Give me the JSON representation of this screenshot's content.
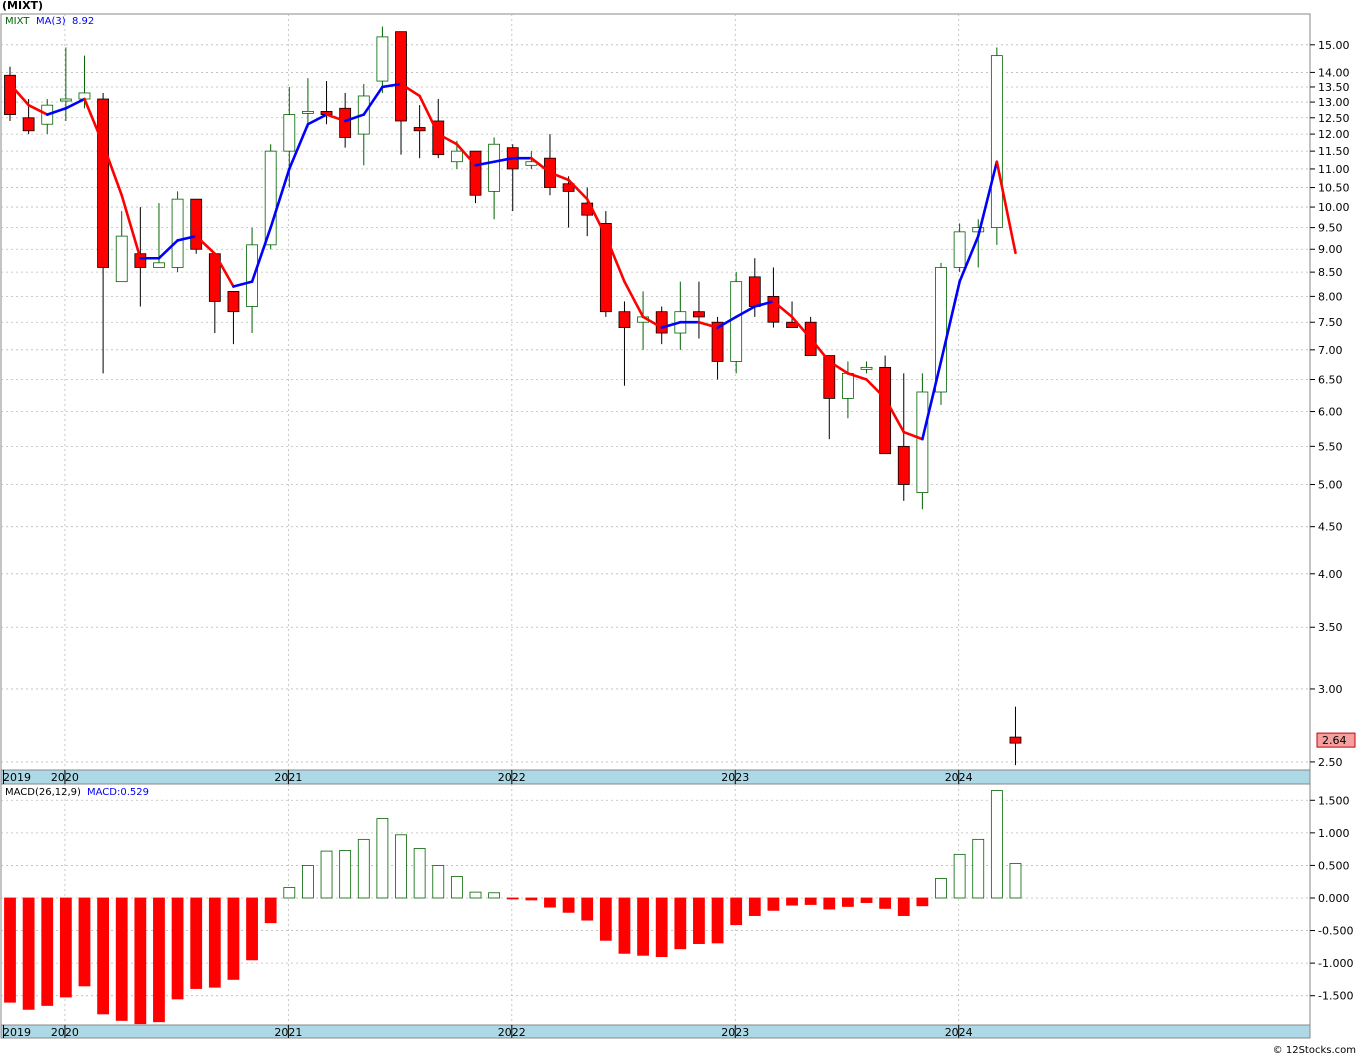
{
  "symbol": "(MIXT)",
  "credit": "© 12Stocks.com",
  "colors": {
    "up": "#006400",
    "down": "#ff0000",
    "ma_up": "#0000ff",
    "ma_down": "#ff0000",
    "axis_band": "#add8e6",
    "grid": "#bbbbbb"
  },
  "chart_data": [
    {
      "type": "candlestick",
      "legend": {
        "symbol": "MIXT",
        "ma_label": "MA(3)",
        "ma_value": "8.92"
      },
      "scale": "log",
      "ylim": [
        2.45,
        16.2
      ],
      "price_ticks": [
        "2.50",
        "3.00",
        "3.50",
        "4.00",
        "4.50",
        "5.00",
        "5.50",
        "6.00",
        "6.50",
        "7.00",
        "7.50",
        "8.00",
        "8.50",
        "9.00",
        "9.50",
        "10.00",
        "10.50",
        "11.00",
        "11.50",
        "12.00",
        "12.50",
        "13.00",
        "13.50",
        "14.00",
        "15.00"
      ],
      "year_labels": [
        "2019",
        "2020",
        "2021",
        "2022",
        "2023",
        "2024"
      ],
      "last_price_label": "2.64",
      "candles": [
        {
          "date": "2019-11",
          "o": 13.9,
          "h": 14.2,
          "l": 12.4,
          "c": 12.6
        },
        {
          "date": "2019-12",
          "o": 12.5,
          "h": 13.1,
          "l": 12.0,
          "c": 12.1
        },
        {
          "date": "2020-01",
          "o": 12.3,
          "h": 13.1,
          "l": 12.0,
          "c": 12.9
        },
        {
          "date": "2020-02",
          "o": 13.1,
          "h": 14.9,
          "l": 12.4,
          "c": 13.1
        },
        {
          "date": "2020-03",
          "o": 13.1,
          "h": 14.6,
          "l": 12.8,
          "c": 13.3
        },
        {
          "date": "2020-04",
          "o": 13.1,
          "h": 13.3,
          "l": 6.6,
          "c": 8.6
        },
        {
          "date": "2020-05",
          "o": 8.3,
          "h": 9.9,
          "l": 8.3,
          "c": 9.3
        },
        {
          "date": "2020-06",
          "o": 8.9,
          "h": 10.0,
          "l": 7.8,
          "c": 8.6
        },
        {
          "date": "2020-07",
          "o": 8.6,
          "h": 10.1,
          "l": 8.6,
          "c": 8.7
        },
        {
          "date": "2020-08",
          "o": 8.6,
          "h": 10.4,
          "l": 8.5,
          "c": 10.2
        },
        {
          "date": "2020-09",
          "o": 10.2,
          "h": 10.2,
          "l": 8.9,
          "c": 9.0
        },
        {
          "date": "2020-10",
          "o": 8.9,
          "h": 8.9,
          "l": 7.3,
          "c": 7.9
        },
        {
          "date": "2020-11",
          "o": 8.1,
          "h": 8.1,
          "l": 7.1,
          "c": 7.7
        },
        {
          "date": "2020-12",
          "o": 7.8,
          "h": 9.5,
          "l": 7.3,
          "c": 9.1
        },
        {
          "date": "2021-01",
          "o": 9.1,
          "h": 11.7,
          "l": 9.0,
          "c": 11.5
        },
        {
          "date": "2021-02",
          "o": 11.5,
          "h": 13.5,
          "l": 10.5,
          "c": 12.6
        },
        {
          "date": "2021-03",
          "o": 12.7,
          "h": 13.8,
          "l": 12.2,
          "c": 12.7
        },
        {
          "date": "2021-04",
          "o": 12.7,
          "h": 13.7,
          "l": 12.3,
          "c": 12.6
        },
        {
          "date": "2021-05",
          "o": 12.8,
          "h": 13.3,
          "l": 11.6,
          "c": 11.9
        },
        {
          "date": "2021-06",
          "o": 12.0,
          "h": 13.6,
          "l": 11.1,
          "c": 13.2
        },
        {
          "date": "2021-07",
          "o": 13.7,
          "h": 15.7,
          "l": 13.3,
          "c": 15.3
        },
        {
          "date": "2021-08",
          "o": 15.5,
          "h": 15.5,
          "l": 11.4,
          "c": 12.4
        },
        {
          "date": "2021-09",
          "o": 12.2,
          "h": 12.9,
          "l": 11.3,
          "c": 12.1
        },
        {
          "date": "2021-10",
          "o": 12.4,
          "h": 13.1,
          "l": 11.3,
          "c": 11.4
        },
        {
          "date": "2021-11",
          "o": 11.2,
          "h": 11.8,
          "l": 11.0,
          "c": 11.5
        },
        {
          "date": "2021-12",
          "o": 11.5,
          "h": 11.5,
          "l": 10.1,
          "c": 10.3
        },
        {
          "date": "2022-01",
          "o": 10.4,
          "h": 11.9,
          "l": 9.7,
          "c": 11.7
        },
        {
          "date": "2022-02",
          "o": 11.6,
          "h": 11.7,
          "l": 9.9,
          "c": 11.0
        },
        {
          "date": "2022-03",
          "o": 11.1,
          "h": 11.5,
          "l": 11.0,
          "c": 11.2
        },
        {
          "date": "2022-04",
          "o": 11.3,
          "h": 12.0,
          "l": 10.3,
          "c": 10.5
        },
        {
          "date": "2022-05",
          "o": 10.6,
          "h": 10.8,
          "l": 9.5,
          "c": 10.4
        },
        {
          "date": "2022-06",
          "o": 10.1,
          "h": 10.5,
          "l": 9.3,
          "c": 9.8
        },
        {
          "date": "2022-07",
          "o": 9.6,
          "h": 9.9,
          "l": 7.6,
          "c": 7.7
        },
        {
          "date": "2022-08",
          "o": 7.7,
          "h": 7.9,
          "l": 6.4,
          "c": 7.4
        },
        {
          "date": "2022-09",
          "o": 7.5,
          "h": 8.1,
          "l": 7.0,
          "c": 7.6
        },
        {
          "date": "2022-10",
          "o": 7.7,
          "h": 7.8,
          "l": 7.1,
          "c": 7.3
        },
        {
          "date": "2022-11",
          "o": 7.3,
          "h": 8.3,
          "l": 7.0,
          "c": 7.7
        },
        {
          "date": "2022-12",
          "o": 7.7,
          "h": 8.3,
          "l": 7.2,
          "c": 7.6
        },
        {
          "date": "2023-01",
          "o": 7.5,
          "h": 7.6,
          "l": 6.5,
          "c": 6.8
        },
        {
          "date": "2023-02",
          "o": 6.8,
          "h": 8.5,
          "l": 6.6,
          "c": 8.3
        },
        {
          "date": "2023-03",
          "o": 8.4,
          "h": 8.8,
          "l": 7.6,
          "c": 7.8
        },
        {
          "date": "2023-04",
          "o": 8.0,
          "h": 8.6,
          "l": 7.4,
          "c": 7.5
        },
        {
          "date": "2023-05",
          "o": 7.5,
          "h": 7.9,
          "l": 7.4,
          "c": 7.4
        },
        {
          "date": "2023-06",
          "o": 7.5,
          "h": 7.6,
          "l": 6.9,
          "c": 6.9
        },
        {
          "date": "2023-07",
          "o": 6.9,
          "h": 6.9,
          "l": 5.6,
          "c": 6.2
        },
        {
          "date": "2023-08",
          "o": 6.2,
          "h": 6.8,
          "l": 5.9,
          "c": 6.6
        },
        {
          "date": "2023-09",
          "o": 6.7,
          "h": 6.8,
          "l": 6.6,
          "c": 6.7
        },
        {
          "date": "2023-10",
          "o": 6.7,
          "h": 6.9,
          "l": 5.4,
          "c": 5.4
        },
        {
          "date": "2023-11",
          "o": 5.5,
          "h": 6.6,
          "l": 4.8,
          "c": 5.0
        },
        {
          "date": "2023-12",
          "o": 4.9,
          "h": 6.6,
          "l": 4.7,
          "c": 6.3
        },
        {
          "date": "2024-01",
          "o": 6.3,
          "h": 8.7,
          "l": 6.1,
          "c": 8.6
        },
        {
          "date": "2024-02",
          "o": 8.6,
          "h": 9.6,
          "l": 8.5,
          "c": 9.4
        },
        {
          "date": "2024-03",
          "o": 9.4,
          "h": 9.7,
          "l": 8.6,
          "c": 9.5
        },
        {
          "date": "2024-04",
          "o": 9.5,
          "h": 14.9,
          "l": 9.1,
          "c": 14.6
        },
        {
          "date": "2024-05",
          "o": 2.66,
          "h": 2.87,
          "l": 2.48,
          "c": 2.62
        }
      ],
      "ma3": [
        13.6,
        12.9,
        12.6,
        12.8,
        13.1,
        11.7,
        10.3,
        8.8,
        8.8,
        9.2,
        9.3,
        8.9,
        8.2,
        8.3,
        9.5,
        11.0,
        12.3,
        12.6,
        12.4,
        12.6,
        13.5,
        13.6,
        13.2,
        12.0,
        11.7,
        11.1,
        11.2,
        11.3,
        11.3,
        10.9,
        10.7,
        10.2,
        9.3,
        8.3,
        7.6,
        7.4,
        7.5,
        7.5,
        7.4,
        7.6,
        7.8,
        7.9,
        7.6,
        7.2,
        6.8,
        6.6,
        6.5,
        6.2,
        5.7,
        5.6,
        6.8,
        8.3,
        9.3,
        11.2,
        8.92
      ]
    },
    {
      "type": "bar",
      "legend": {
        "label": "MACD(26,12,9)",
        "value_label": "MACD:0.529"
      },
      "ylim": [
        -1.95,
        1.75
      ],
      "ticks": [
        "1.500",
        "1.000",
        "0.500",
        "0.000",
        "-0.500",
        "-1.000",
        "-1.500"
      ],
      "values": [
        -1.6,
        -1.71,
        -1.65,
        -1.52,
        -1.35,
        -1.78,
        -1.88,
        -1.93,
        -1.9,
        -1.55,
        -1.39,
        -1.37,
        -1.25,
        -0.95,
        -0.38,
        0.16,
        0.5,
        0.72,
        0.73,
        0.9,
        1.22,
        0.97,
        0.76,
        0.5,
        0.33,
        0.09,
        0.08,
        -0.01,
        -0.03,
        -0.14,
        -0.22,
        -0.34,
        -0.65,
        -0.85,
        -0.88,
        -0.9,
        -0.78,
        -0.7,
        -0.69,
        -0.41,
        -0.27,
        -0.19,
        -0.11,
        -0.1,
        -0.17,
        -0.13,
        -0.07,
        -0.16,
        -0.27,
        -0.12,
        0.3,
        0.67,
        0.9,
        1.65,
        0.529
      ]
    }
  ]
}
